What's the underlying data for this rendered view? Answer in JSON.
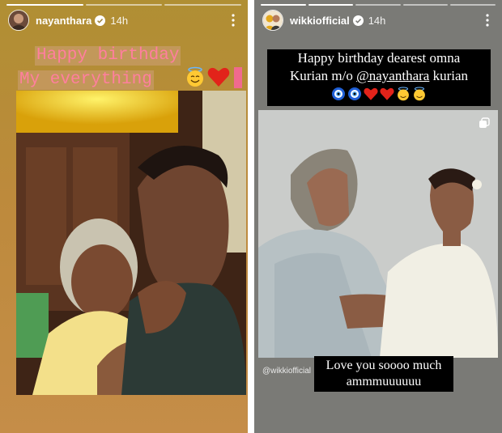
{
  "left_story": {
    "username": "nayanthara",
    "time": "14h",
    "text_line1": "Happy birthday",
    "text_line2": "My everything"
  },
  "right_story": {
    "username": "wikkiofficial",
    "time": "14h",
    "caption_line1": "Happy birthday dearest omna",
    "caption_line2_pre": "Kurian m/o ",
    "caption_mention": "@nayanthara",
    "caption_line2_post": " kurian",
    "watermark": "@wikkiofficial",
    "love_line1": "Love you soooo much",
    "love_line2": "ammmuuuuuu"
  },
  "colors": {
    "pink_text": "#ff7f9e",
    "verified_blue": "#3897f0"
  },
  "icons": {
    "verified": "verified-badge-icon",
    "more": "more-vertical-icon",
    "halo_emoji": "smiling-face-with-halo",
    "heart_emoji": "red-heart",
    "nazar_emoji": "nazar-amulet",
    "copy": "copy-icon"
  }
}
